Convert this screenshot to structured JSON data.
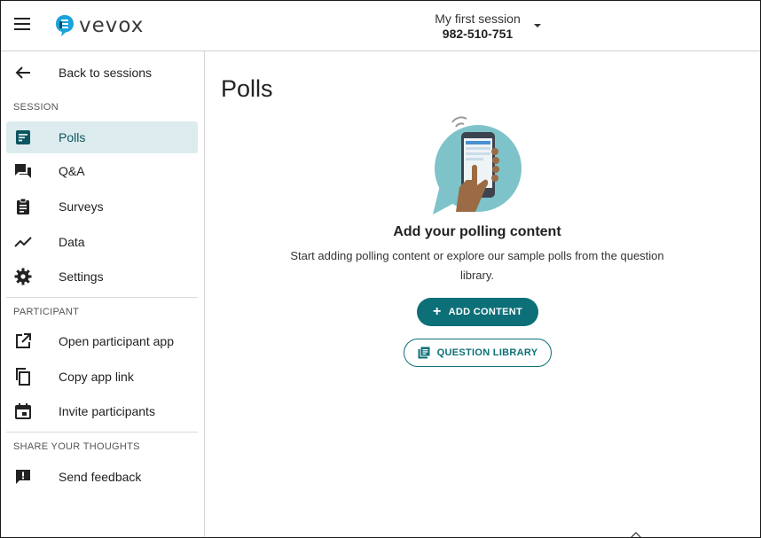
{
  "header": {
    "logo_text": "vevox",
    "session_name": "My first session",
    "session_code": "982-510-751"
  },
  "sidebar": {
    "back_label": "Back to sessions",
    "section_session": "SESSION",
    "items_session": [
      {
        "label": "Polls",
        "icon": "polls-icon",
        "active": true
      },
      {
        "label": "Q&A",
        "icon": "qa-icon"
      },
      {
        "label": "Surveys",
        "icon": "clipboard-icon"
      },
      {
        "label": "Data",
        "icon": "chart-line-icon"
      },
      {
        "label": "Settings",
        "icon": "gear-icon"
      }
    ],
    "section_participant": "PARTICIPANT",
    "items_participant": [
      {
        "label": "Open participant app",
        "icon": "open-external-icon"
      },
      {
        "label": "Copy app link",
        "icon": "copy-icon"
      },
      {
        "label": "Invite participants",
        "icon": "calendar-icon"
      }
    ],
    "section_feedback": "SHARE YOUR THOUGHTS",
    "items_feedback": [
      {
        "label": "Send feedback",
        "icon": "feedback-icon"
      }
    ]
  },
  "main": {
    "title": "Polls",
    "empty_title": "Add your polling content",
    "empty_desc": "Start adding polling content or explore our sample polls from the question library.",
    "add_button": "ADD CONTENT",
    "library_button": "QUESTION LIBRARY"
  },
  "colors": {
    "accent": "#0d6f77",
    "active_bg": "#dcecee",
    "logo_blue": "#1aa3d9"
  }
}
